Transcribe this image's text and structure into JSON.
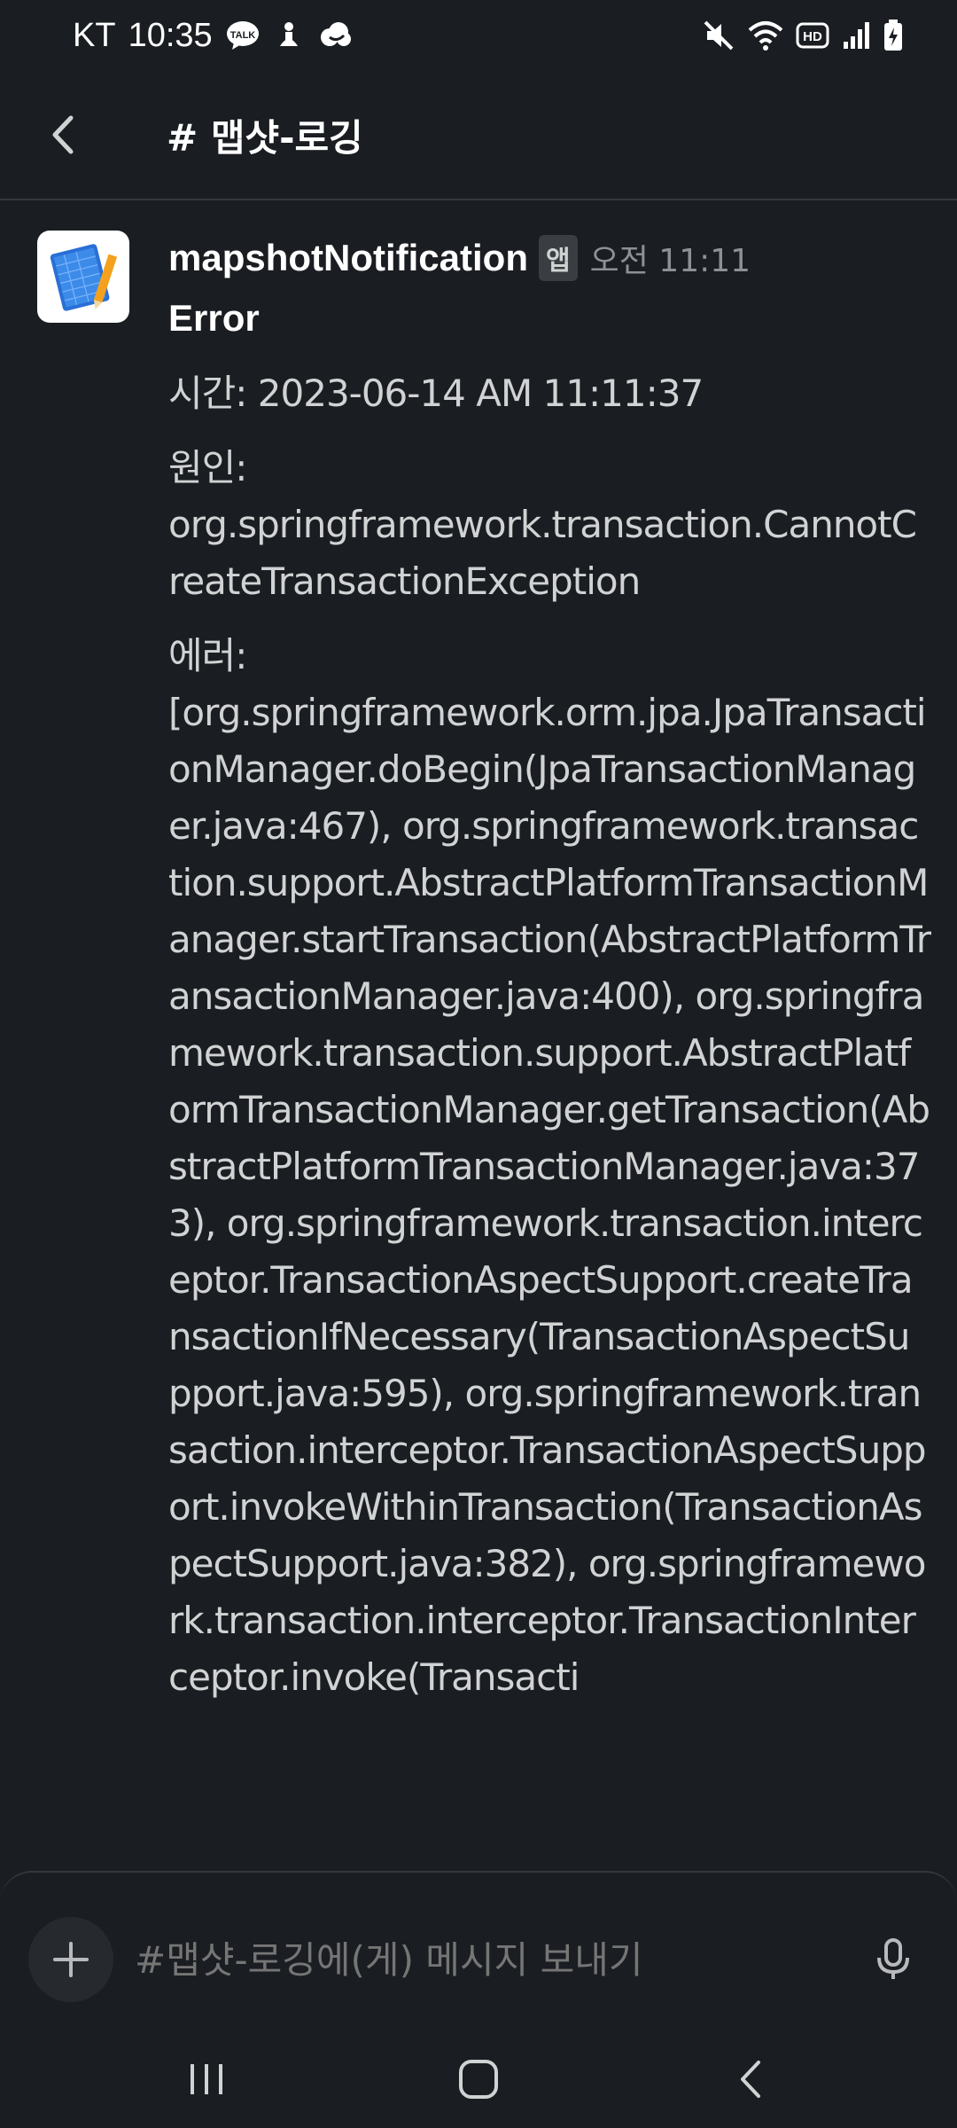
{
  "status_bar": {
    "carrier": "KT",
    "time": "10:35",
    "notification_icons": [
      "talk-icon",
      "nike-icon",
      "cloud-icon"
    ],
    "system_icons": [
      "mute-icon",
      "wifi-icon",
      "hd-icon",
      "signal-icon",
      "battery-icon"
    ],
    "hd_label": "HD",
    "talk_label": "TALK"
  },
  "header": {
    "channel_name": "# 맵샷-로깅"
  },
  "message": {
    "sender": "mapshotNotification",
    "badge": "앱",
    "timestamp": "오전 11:11",
    "title": "Error",
    "time_field": "시간: 2023-06-14 AM 11:11:37",
    "cause_label": "원인:",
    "cause_value": "org.springframework.transaction.CannotCreateTransactionException",
    "error_label": "에러:",
    "error_value": "[org.springframework.orm.jpa.JpaTransactionManager.doBegin(JpaTransactionManager.java:467), org.springframework.transaction.support.AbstractPlatformTransactionManager.startTransaction(AbstractPlatformTransactionManager.java:400), org.springframework.transaction.support.AbstractPlatformTransactionManager.getTransaction(AbstractPlatformTransactionManager.java:373), org.springframework.transaction.interceptor.TransactionAspectSupport.createTransactionIfNecessary(TransactionAspectSupport.java:595), org.springframework.transaction.interceptor.TransactionAspectSupport.invokeWithinTransaction(TransactionAspectSupport.java:382), org.springframework.transaction.interceptor.TransactionInterceptor.invoke(Transacti"
  },
  "composer": {
    "placeholder": "#맵샷-로깅에(게) 메시지 보내기"
  },
  "colors": {
    "background": "#1a1d21",
    "text": "#d1d2d3",
    "muted": "#8e9094",
    "divider": "#34373b"
  }
}
